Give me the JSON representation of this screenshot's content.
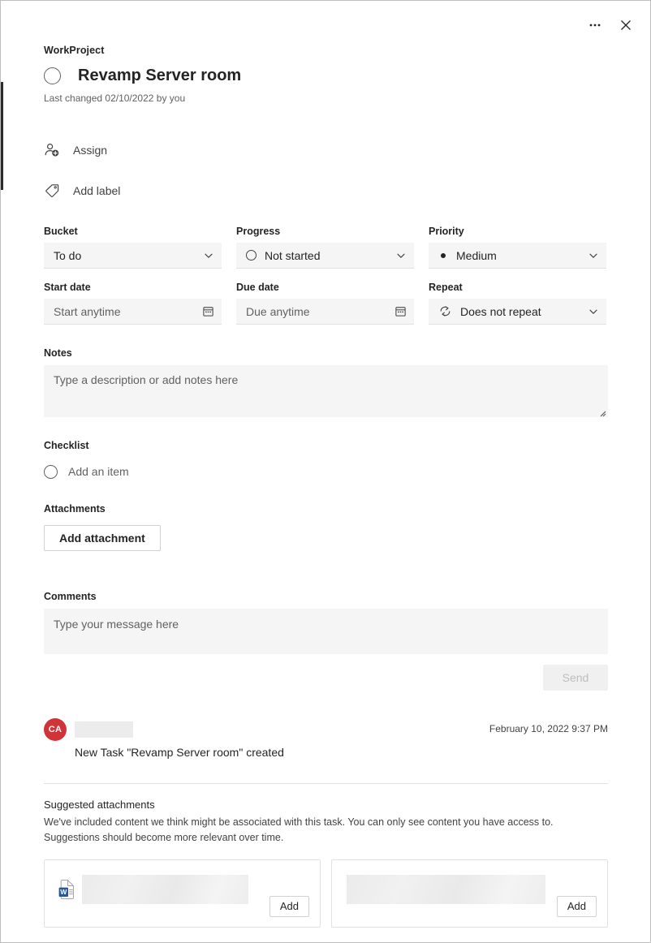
{
  "window": {
    "more_options_icon": "ellipsis-icon",
    "close_icon": "close-icon"
  },
  "header": {
    "project_name": "WorkProject",
    "task_title": "Revamp Server room",
    "last_changed": "Last changed 02/10/2022 by you",
    "complete_checkbox_icon": "circle-unchecked-icon"
  },
  "quick_actions": [
    {
      "label": "Assign",
      "icon": "person-add-icon"
    },
    {
      "label": "Add label",
      "icon": "tag-icon"
    }
  ],
  "fields": {
    "bucket": {
      "label": "Bucket",
      "value": "To do",
      "chevron_icon": "chevron-down-icon"
    },
    "progress": {
      "label": "Progress",
      "value": "Not started",
      "lead_icon": "circle-empty-icon",
      "chevron_icon": "chevron-down-icon"
    },
    "priority": {
      "label": "Priority",
      "value": "Medium",
      "lead_icon": "dot-icon",
      "chevron_icon": "chevron-down-icon"
    },
    "start_date": {
      "label": "Start date",
      "placeholder": "Start anytime",
      "trail_icon": "calendar-icon"
    },
    "due_date": {
      "label": "Due date",
      "placeholder": "Due anytime",
      "trail_icon": "calendar-icon"
    },
    "repeat": {
      "label": "Repeat",
      "value": "Does not repeat",
      "lead_icon": "repeat-icon",
      "chevron_icon": "chevron-down-icon"
    }
  },
  "notes": {
    "label": "Notes",
    "placeholder": "Type a description or add notes here",
    "resize_icon": "resize-grip-icon"
  },
  "checklist": {
    "label": "Checklist",
    "add_item_placeholder": "Add an item",
    "circle_icon": "circle-unchecked-icon"
  },
  "attachments": {
    "label": "Attachments",
    "add_button": "Add attachment"
  },
  "comments": {
    "label": "Comments",
    "placeholder": "Type your message here",
    "send_button": "Send"
  },
  "activity": {
    "avatar_initials": "CA",
    "author_redacted": "",
    "timestamp": "February 10, 2022 9:37 PM",
    "text": "New Task \"Revamp Server room\" created"
  },
  "suggested": {
    "title": "Suggested attachments",
    "description": "We've included content we think might be associated with this task. You can only see content you have access to. Suggestions should become more relevant over time.",
    "cards": [
      {
        "file_icon": "word-document-icon",
        "name_redacted": "",
        "add_button": "Add"
      },
      {
        "file_icon": "",
        "name_redacted": "",
        "add_button": "Add"
      }
    ]
  },
  "colors": {
    "accent_avatar": "#d13438",
    "field_background": "#f5f5f5",
    "text_primary": "#242424",
    "text_secondary": "#616161",
    "border": "#e1e1e1"
  }
}
